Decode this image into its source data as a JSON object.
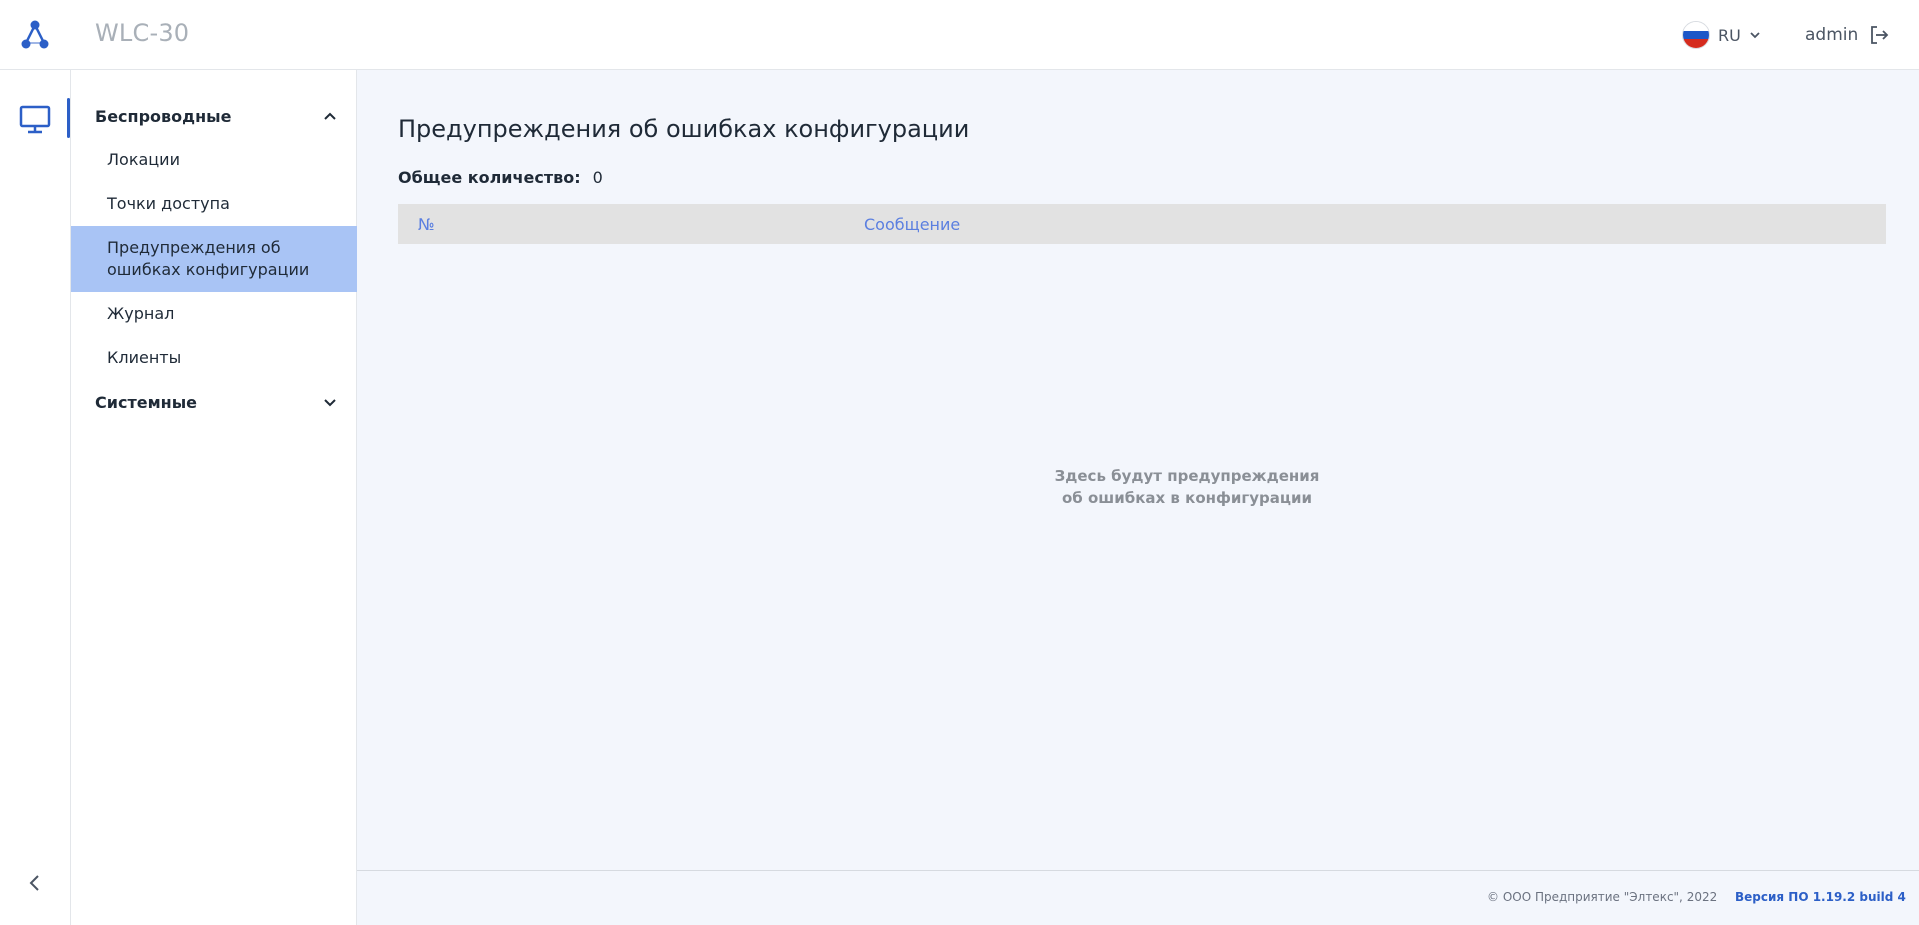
{
  "header": {
    "app_title": "WLC-30",
    "language": "RU",
    "user": "admin"
  },
  "icons": {
    "logo": "network-logo-icon",
    "monitor": "monitor-icon",
    "collapse": "chevron-left-icon",
    "logout": "logout-icon",
    "flag": "russia-flag-icon"
  },
  "sidebar": {
    "groups": [
      {
        "label": "Беспроводные",
        "expanded": true,
        "items": [
          {
            "label": "Локации"
          },
          {
            "label": "Точки доступа"
          },
          {
            "label": "Предупреждения об ошибках конфигурации",
            "active": true
          },
          {
            "label": "Журнал"
          },
          {
            "label": "Клиенты"
          }
        ]
      },
      {
        "label": "Системные",
        "expanded": false,
        "items": []
      }
    ]
  },
  "main": {
    "title": "Предупреждения об ошибках конфигурации",
    "total_label": "Общее количество:",
    "total_value": "0",
    "columns": [
      "№",
      "Сообщение"
    ],
    "empty_line1": "Здесь будут предупреждения",
    "empty_line2": "об ошибках в конфигурации"
  },
  "footer": {
    "copyright": "© ООО Предприятие \"Элтекс\", 2022",
    "version": "Версия ПО 1.19.2 build 4"
  },
  "colors": {
    "accent": "#2c5fc7",
    "active_item": "#a9c4f5",
    "table_header": "#e2e2e2",
    "column_text": "#5b7fe0",
    "background": "#f3f6fc"
  }
}
